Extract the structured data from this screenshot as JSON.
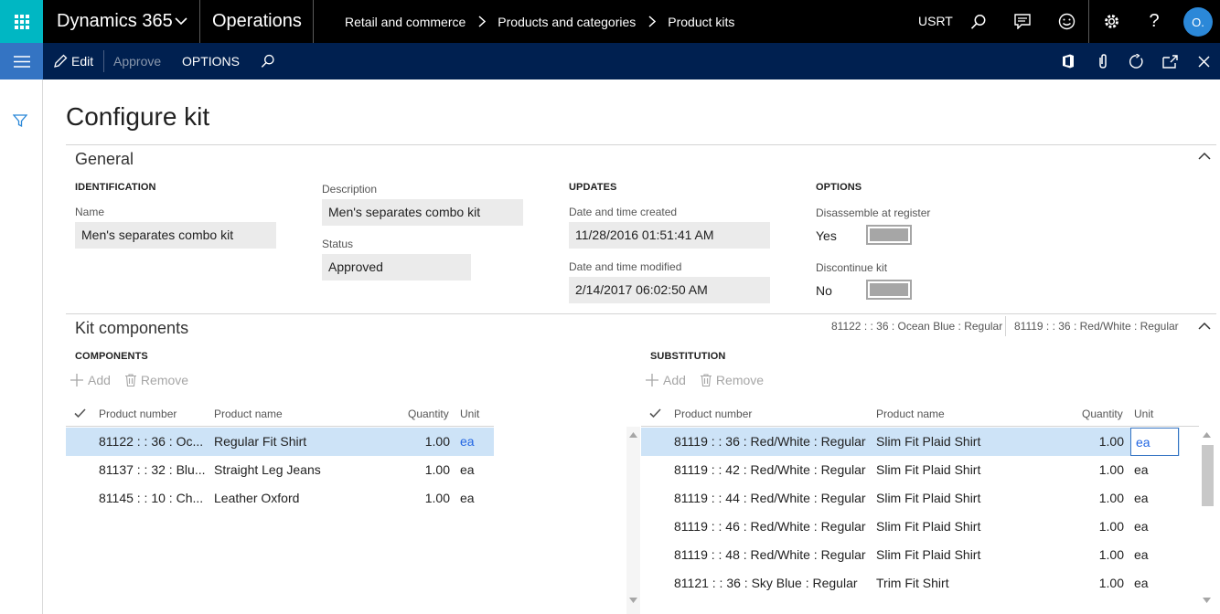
{
  "topbar": {
    "brand": "Dynamics 365",
    "module": "Operations",
    "breadcrumbs": [
      "Retail and commerce",
      "Products and categories",
      "Product kits"
    ],
    "company": "USRT",
    "avatar_initials": "O.",
    "colors": {
      "waffle": "#00b7c3",
      "bar": "#000000",
      "avatar": "#2b88d8"
    }
  },
  "actionbar": {
    "edit_label": "Edit",
    "approve_label": "Approve",
    "options_label": "OPTIONS",
    "color": "#002050"
  },
  "page": {
    "title": "Configure kit"
  },
  "general": {
    "title": "General",
    "identification": {
      "header": "IDENTIFICATION",
      "name_label": "Name",
      "name_value": "Men's separates combo kit",
      "description_label": "Description",
      "description_value": "Men's separates combo kit",
      "status_label": "Status",
      "status_value": "Approved"
    },
    "updates": {
      "header": "UPDATES",
      "created_label": "Date and time created",
      "created_value": "11/28/2016 01:51:41 AM",
      "modified_label": "Date and time modified",
      "modified_value": "2/14/2017 06:02:50 AM"
    },
    "options": {
      "header": "OPTIONS",
      "disassemble_label": "Disassemble at register",
      "disassemble_value": "Yes",
      "discontinue_label": "Discontinue kit",
      "discontinue_value": "No"
    }
  },
  "kit": {
    "title": "Kit components",
    "related": [
      "81122 : : 36 : Ocean Blue : Regular",
      "81119 : : 36 : Red/White : Regular"
    ],
    "components": {
      "header": "COMPONENTS",
      "add_label": "Add",
      "remove_label": "Remove",
      "columns": [
        "Product number",
        "Product name",
        "Quantity",
        "Unit"
      ],
      "rows": [
        {
          "number": "81122 : : 36 : Oc...",
          "name": "Regular Fit Shirt",
          "qty": "1.00",
          "unit": "ea"
        },
        {
          "number": "81137 : : 32 : Blu...",
          "name": "Straight Leg Jeans",
          "qty": "1.00",
          "unit": "ea"
        },
        {
          "number": "81145 : : 10 : Ch...",
          "name": "Leather Oxford",
          "qty": "1.00",
          "unit": "ea"
        }
      ]
    },
    "substitution": {
      "header": "SUBSTITUTION",
      "add_label": "Add",
      "remove_label": "Remove",
      "columns": [
        "Product number",
        "Product name",
        "Quantity",
        "Unit"
      ],
      "rows": [
        {
          "number": "81119 : : 36 : Red/White : Regular",
          "name": "Slim Fit Plaid Shirt",
          "qty": "1.00",
          "unit": "ea"
        },
        {
          "number": "81119 : : 42 : Red/White : Regular",
          "name": "Slim Fit Plaid Shirt",
          "qty": "1.00",
          "unit": "ea"
        },
        {
          "number": "81119 : : 44 : Red/White : Regular",
          "name": "Slim Fit Plaid Shirt",
          "qty": "1.00",
          "unit": "ea"
        },
        {
          "number": "81119 : : 46 : Red/White : Regular",
          "name": "Slim Fit Plaid Shirt",
          "qty": "1.00",
          "unit": "ea"
        },
        {
          "number": "81119 : : 48 : Red/White : Regular",
          "name": "Slim Fit Plaid Shirt",
          "qty": "1.00",
          "unit": "ea"
        },
        {
          "number": "81121 : : 36 : Sky Blue : Regular",
          "name": "Trim Fit Shirt",
          "qty": "1.00",
          "unit": "ea"
        }
      ]
    }
  }
}
